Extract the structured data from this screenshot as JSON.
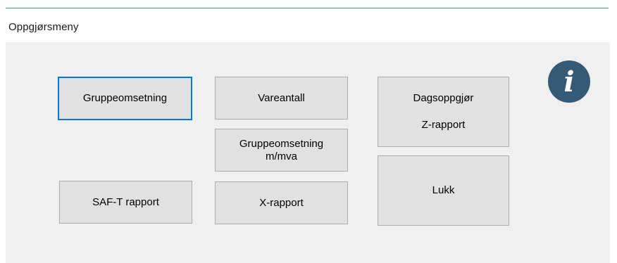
{
  "window": {
    "title": "Oppgjørsmeny"
  },
  "buttons": {
    "gruppeomsetning": "Gruppeomsetning",
    "vareantall": "Vareantall",
    "dagsoppgjor_line1": "Dagsoppgjør",
    "dagsoppgjor_line2": "Z-rapport",
    "gruppeomsetning_mva_line1": "Gruppeomsetning",
    "gruppeomsetning_mva_line2": "m/mva",
    "saft_rapport": "SAF-T rapport",
    "x_rapport": "X-rapport",
    "lukk": "Lukk"
  },
  "info": {
    "glyph": "i",
    "icon": "info-icon",
    "color": "#345a76"
  },
  "colors": {
    "panel_bg": "#f0f0f0",
    "button_bg": "#e1e1e1",
    "button_border": "#adadad",
    "focus_border": "#0078d7",
    "top_line": "#4a90c8"
  }
}
